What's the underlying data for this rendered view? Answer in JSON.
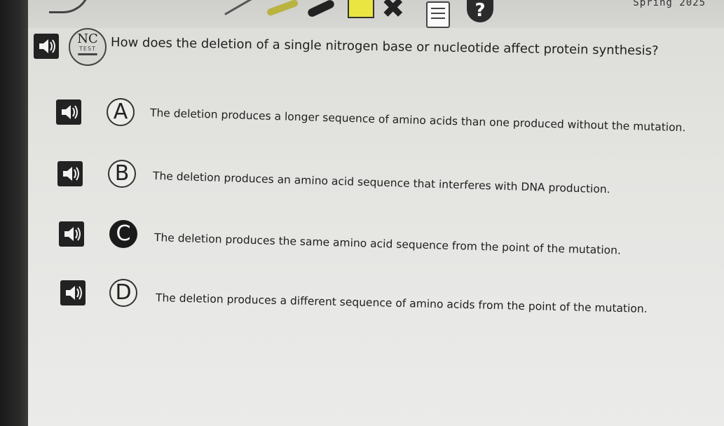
{
  "toolbar": {
    "season": "Spring 2025",
    "tools": [
      {
        "name": "arc-tool-icon"
      },
      {
        "name": "line-tool-icon"
      },
      {
        "name": "pen-tool-icon"
      },
      {
        "name": "marker-tool-icon"
      },
      {
        "name": "highlighter-box-icon"
      },
      {
        "name": "eliminator-x-icon"
      },
      {
        "name": "notepad-icon"
      },
      {
        "name": "help-icon",
        "label": "?"
      }
    ]
  },
  "badge": {
    "top": "NC",
    "bottom": "TEST"
  },
  "question": {
    "text": "How does the deletion of a single nitrogen base or nucleotide affect protein synthesis?"
  },
  "choices": [
    {
      "letter": "A",
      "text": "The deletion produces a longer sequence of amino acids than one produced without the mutation.",
      "selected": false
    },
    {
      "letter": "B",
      "text": "The deletion produces an amino acid sequence that interferes with DNA production.",
      "selected": false
    },
    {
      "letter": "C",
      "text": "The deletion produces the same amino acid sequence from the point of the mutation.",
      "selected": true
    },
    {
      "letter": "D",
      "text": "The deletion produces a different sequence of amino acids from the point of the mutation.",
      "selected": false
    }
  ],
  "colors": {
    "selected_fill": "#1b1b1b",
    "screen_bg": "#e4e4e1",
    "toolbar_highlight": "#eae540"
  }
}
